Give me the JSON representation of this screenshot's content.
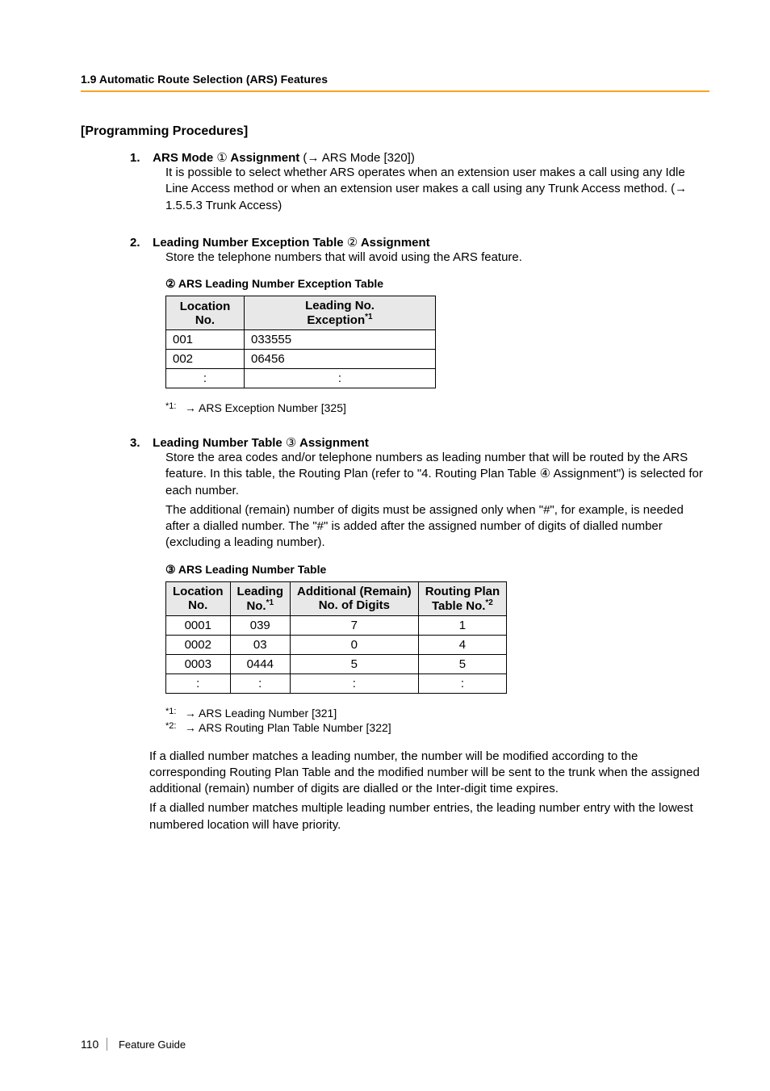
{
  "header": {
    "section_ref": "1.9 Automatic Route Selection (ARS) Features"
  },
  "title": "[Programming Procedures]",
  "items": [
    {
      "num": "1.",
      "title_bold": "ARS Mode ",
      "circ": "①",
      "title_bold2": " Assignment",
      "title_plain": " (",
      "arrow": "→",
      "title_plain2": " ARS Mode [320])",
      "body": [
        "It is possible to select whether ARS operates when an extension user makes a call using any Idle Line Access method or when an extension user makes a call using any Trunk Access method. (",
        "→",
        " 1.5.5.3 Trunk Access)"
      ]
    },
    {
      "num": "2.",
      "title_bold": "Leading Number Exception Table ",
      "circ": "②",
      "title_bold2": " Assignment",
      "body": [
        "Store the telephone numbers that will avoid using the ARS feature."
      ],
      "table_title_circ": "②",
      "table_title": " ARS Leading Number Exception Table",
      "table": {
        "headers": [
          {
            "line1": "Location",
            "line2": "No."
          },
          {
            "line1": "Leading No.",
            "line2_pre": "Exception",
            "line2_sup": "*1"
          }
        ],
        "rows": [
          [
            "001",
            "033555"
          ],
          [
            "002",
            "06456"
          ],
          [
            ":",
            ":"
          ]
        ]
      },
      "footnotes": [
        {
          "label": "*1:",
          "arrow": "→",
          "text": " ARS Exception Number [325]"
        }
      ]
    },
    {
      "num": "3.",
      "title_bold": "Leading Number Table ",
      "circ": "③",
      "title_bold2": " Assignment",
      "body": [
        "Store the area codes and/or telephone numbers as leading number that will be routed by the ARS feature. In this table, the Routing Plan (refer to \"4. Routing Plan Table ④ Assignment\") is selected for each number.",
        "The additional (remain) number of digits must be assigned only when \"#\", for example, is needed after a dialled number. The \"#\" is added after the assigned number of digits of dialled number (excluding a leading number)."
      ],
      "table_title_circ": "③",
      "table_title": " ARS Leading Number Table",
      "table": {
        "headers": [
          {
            "line1": "Location",
            "line2": "No."
          },
          {
            "line1": "Leading",
            "line2_pre": "No.",
            "line2_sup": "*1"
          },
          {
            "line1": "Additional (Remain)",
            "line2": "No. of Digits"
          },
          {
            "line1": "Routing Plan",
            "line2_pre": "Table No.",
            "line2_sup": "*2"
          }
        ],
        "rows": [
          [
            "0001",
            "039",
            "7",
            "1"
          ],
          [
            "0002",
            "03",
            "0",
            "4"
          ],
          [
            "0003",
            "0444",
            "5",
            "5"
          ],
          [
            ":",
            ":",
            ":",
            ":"
          ]
        ]
      },
      "footnotes": [
        {
          "label": "*1:",
          "arrow": "→",
          "text": " ARS Leading Number [321]"
        },
        {
          "label": "*2:",
          "arrow": "→",
          "text": " ARS Routing Plan Table Number [322]"
        }
      ],
      "after": [
        "If a dialled number matches a leading number, the number will be modified according to the corresponding Routing Plan Table and the modified number will be sent to the trunk when the assigned additional (remain) number of digits are dialled or the Inter-digit time expires.",
        "If a dialled number matches multiple leading number entries, the leading number entry with the lowest numbered location will have priority."
      ]
    }
  ],
  "footer": {
    "page": "110",
    "doc": "Feature Guide"
  }
}
